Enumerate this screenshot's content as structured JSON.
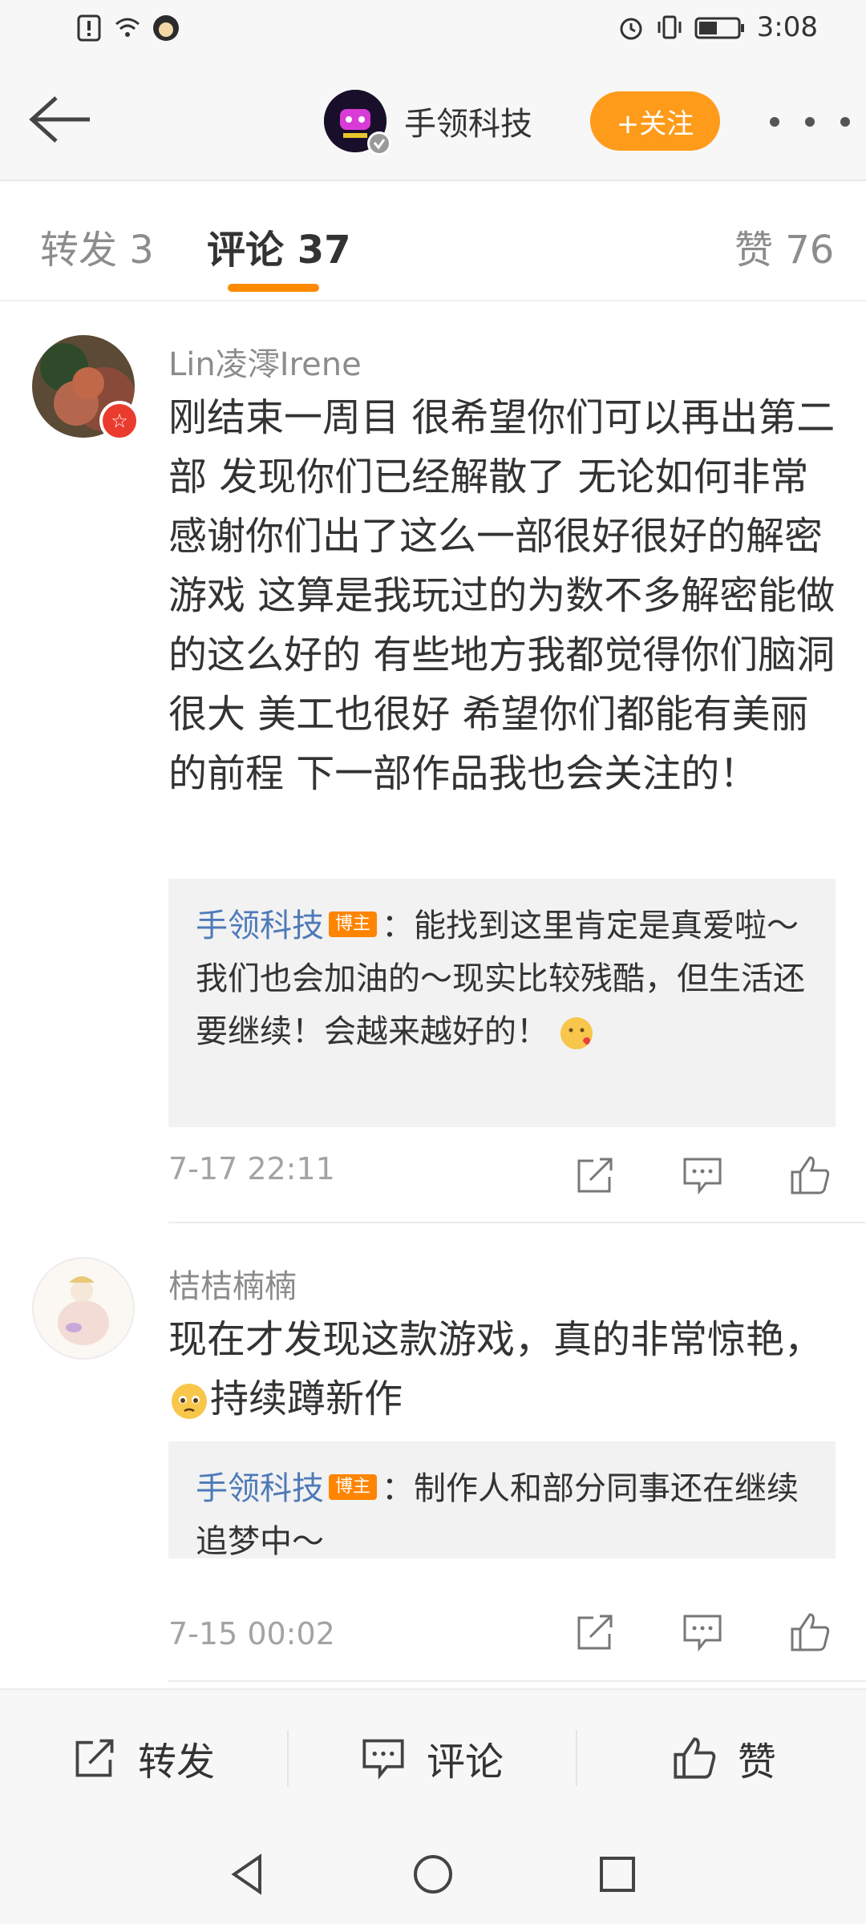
{
  "status_bar": {
    "time": "3:08"
  },
  "header": {
    "author_name": "手领科技",
    "follow_label": "+关注"
  },
  "tabs": [
    {
      "label": "转发 3"
    },
    {
      "label": "评论 37"
    },
    {
      "label": "赞 76"
    }
  ],
  "comments": [
    {
      "username": "Lin凌澪Irene",
      "badge": "☆",
      "text": "刚结束一周目 很希望你们可以再出第二部 发现你们已经解散了 无论如何非常感谢你们出了这么一部很好很好的解密游戏 这算是我玩过的为数不多解密能做的这么好的 有些地方我都觉得你们脑洞很大 美工也很好 希望你们都能有美丽的前程 下一部作品我也会关注的！",
      "reply_author": "手领科技",
      "reply_tag": "博主",
      "reply_text": "：能找到这里肯定是真爱啦～我们也会加油的～现实比较残酷，但生活还要继续！会越来越好的！",
      "timestamp": "7-17 22:11"
    },
    {
      "username": "桔桔楠楠",
      "text_before_emoji": "现在才发现这款游戏，真的非常惊艳，",
      "text_after_emoji": "持续蹲新作",
      "reply_author": "手领科技",
      "reply_tag": "博主",
      "reply_text": "：制作人和部分同事还在继续追梦中～",
      "timestamp": "7-15 00:02"
    }
  ],
  "bottom_bar": {
    "repost_label": "转发",
    "comment_label": "评论",
    "like_label": "赞"
  },
  "colors": {
    "accent_orange": "#ff8a00",
    "link_blue": "#4d7ab8",
    "follow_button": "#ff9b1a"
  }
}
